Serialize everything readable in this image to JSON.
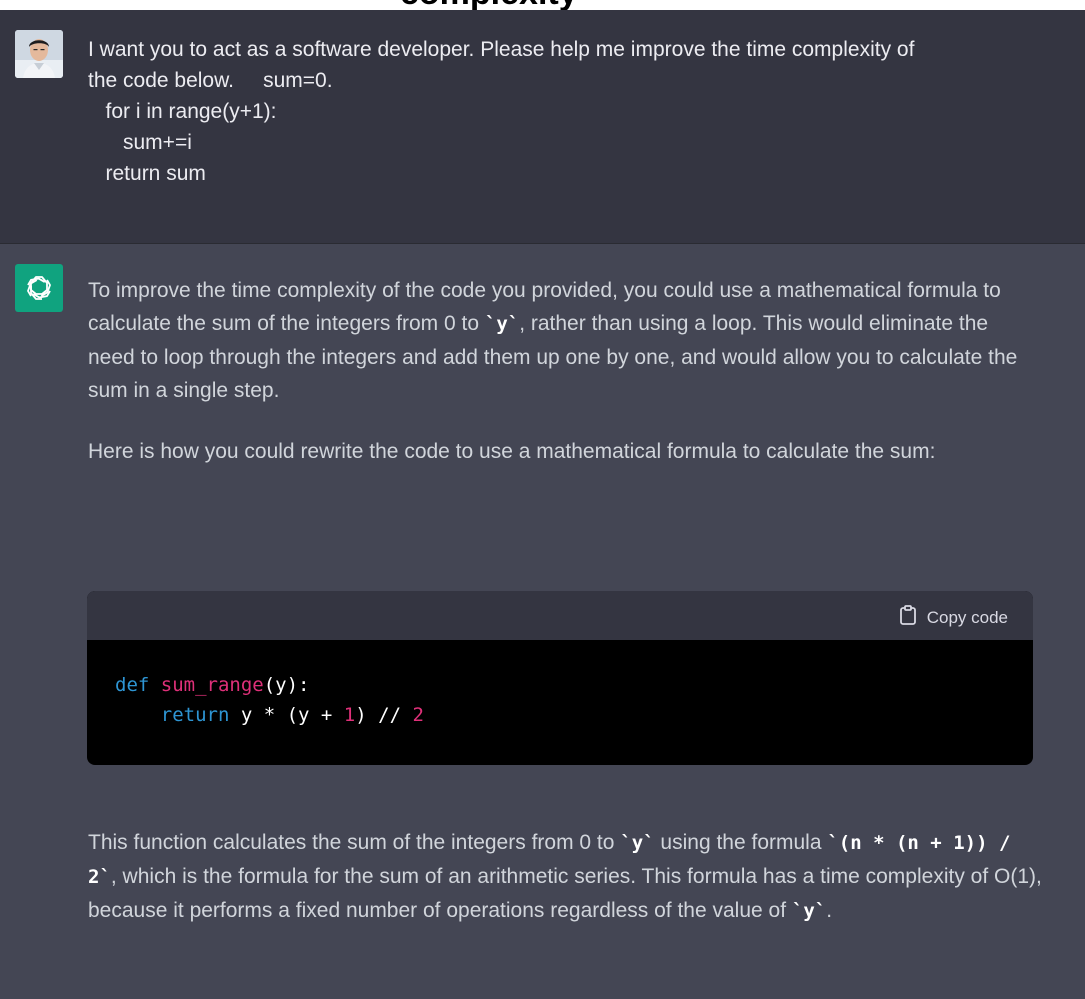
{
  "top_strip_text": "complexity",
  "user_message": {
    "lines": [
      "I want you to act as a software developer. Please help me improve the time complexity of",
      "the code below.     sum=0.",
      "   for i in range(y+1):",
      "      sum+=i",
      "   return sum"
    ]
  },
  "assistant_message": {
    "para1_a": "To improve the time complexity of the code you provided, you could use a mathematical formula to calculate the sum of the integers from 0 to ",
    "para1_code": "`y`",
    "para1_b": ", rather than using a loop. This would eliminate the need to loop through the integers and add them up one by one, and would allow you to calculate the sum in a single step.",
    "para2": "Here is how you could rewrite the code to use a mathematical formula to calculate the sum:",
    "copy_label": "Copy code",
    "code": {
      "line1_kw": "def",
      "line1_fn": "sum_range",
      "line1_rest": "(y):",
      "line2_kw": "return",
      "line2_a": " y * (y + ",
      "line2_num1": "1",
      "line2_b": ") // ",
      "line2_num2": "2"
    },
    "para3_a": "This function calculates the sum of the integers from 0 to ",
    "para3_code1": "`y`",
    "para3_b": " using the formula ",
    "para3_code2": "`(n * (n + 1)) / 2`",
    "para3_c": ", which is the formula for the sum of an arithmetic series. This formula has a time complexity of O(1), because it performs a fixed number of operations regardless of the value of ",
    "para3_code3": "`y`",
    "para3_d": "."
  },
  "colors": {
    "user_bg": "#343541",
    "assistant_bg": "#444654",
    "logo_green": "#10a37f",
    "keyword_blue": "#2e95d3",
    "function_pink": "#df3079"
  },
  "icons": [
    "user-avatar",
    "chatgpt-logo-icon",
    "clipboard-icon"
  ]
}
